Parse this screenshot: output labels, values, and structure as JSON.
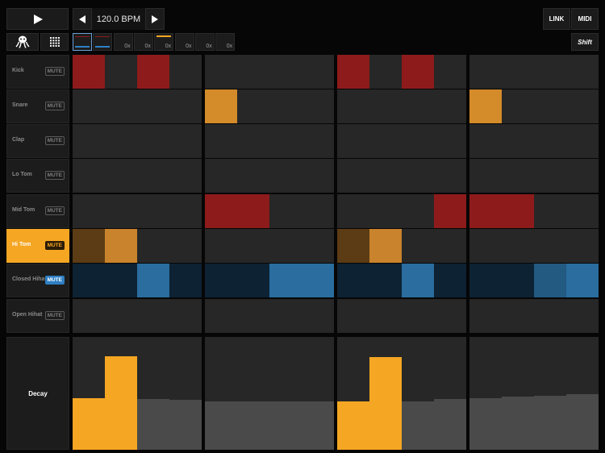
{
  "transport": {
    "play_icon": "play-icon",
    "tempo_down_icon": "arrow-left-icon",
    "tempo_up_icon": "arrow-right-icon",
    "bpm": "120.0 BPM"
  },
  "top_right": {
    "link": "LINK",
    "midi": "MIDI",
    "shift": "Shift"
  },
  "tools": {
    "logo_icon": "octopus-logo-icon",
    "grid_icon": "grid-icon"
  },
  "patterns": [
    {
      "label": "",
      "selected": true
    },
    {
      "label": "",
      "selected": false
    },
    {
      "label": "0x",
      "selected": false
    },
    {
      "label": "0x",
      "selected": false
    },
    {
      "label": "0x",
      "selected": false
    },
    {
      "label": "0x",
      "selected": false
    },
    {
      "label": "0x",
      "selected": false
    },
    {
      "label": "0x",
      "selected": false
    }
  ],
  "tracks": [
    {
      "name": "Kick",
      "mute": "MUTE"
    },
    {
      "name": "Snare",
      "mute": "MUTE"
    },
    {
      "name": "Clap",
      "mute": "MUTE"
    },
    {
      "name": "Lo Tom",
      "mute": "MUTE"
    },
    {
      "name": "Mid Tom",
      "mute": "MUTE"
    },
    {
      "name": "Hi Tom",
      "mute": "MUTE"
    },
    {
      "name": "Closed Hihat",
      "mute": "MUTE"
    },
    {
      "name": "Open Hihat",
      "mute": "MUTE"
    }
  ],
  "selected_track": 5,
  "colors": {
    "kick_on": "#8e1b1b",
    "snare_on": "#d48b2a",
    "tom_on": "#8e1b1b",
    "hitom_on_bright": "#c9832c",
    "hitom_on_dim": "#5b3c14",
    "hihat_on": "#2a6d9e",
    "hihat_on_alt": "#235a82",
    "hihat_off": "#0d2233",
    "accent": "#f5a623",
    "off": "#272727"
  },
  "grid": {
    "Kick": [
      1,
      0,
      1,
      0,
      0,
      0,
      0,
      0,
      1,
      0,
      1,
      0,
      0,
      0,
      0,
      0
    ],
    "Snare": [
      0,
      0,
      0,
      0,
      1,
      0,
      0,
      0,
      0,
      0,
      0,
      0,
      1,
      0,
      0,
      0
    ],
    "Clap": [
      0,
      0,
      0,
      0,
      0,
      0,
      0,
      0,
      0,
      0,
      0,
      0,
      0,
      0,
      0,
      0
    ],
    "Lo Tom": [
      0,
      0,
      0,
      0,
      0,
      0,
      0,
      0,
      0,
      0,
      0,
      0,
      0,
      0,
      0,
      0
    ],
    "Mid Tom": [
      0,
      0,
      0,
      0,
      1,
      1,
      0,
      0,
      0,
      0,
      0,
      1,
      1,
      1,
      0,
      0
    ],
    "Hi Tom": [
      2,
      1,
      0,
      0,
      0,
      0,
      0,
      0,
      2,
      1,
      0,
      0,
      0,
      0,
      0,
      0
    ],
    "Closed Hihat": [
      3,
      3,
      1,
      3,
      3,
      3,
      1,
      1,
      3,
      3,
      1,
      3,
      3,
      3,
      4,
      1
    ],
    "Open Hihat": [
      0,
      0,
      0,
      0,
      0,
      0,
      0,
      0,
      0,
      0,
      0,
      0,
      0,
      0,
      0,
      0
    ]
  },
  "decay": {
    "label": "Decay",
    "values": [
      0.46,
      0.83,
      0.45,
      0.44,
      0.43,
      0.43,
      0.43,
      0.43,
      0.43,
      0.82,
      0.43,
      0.45,
      0.46,
      0.47,
      0.48,
      0.49
    ],
    "active_steps": [
      0,
      1,
      8,
      9
    ]
  }
}
